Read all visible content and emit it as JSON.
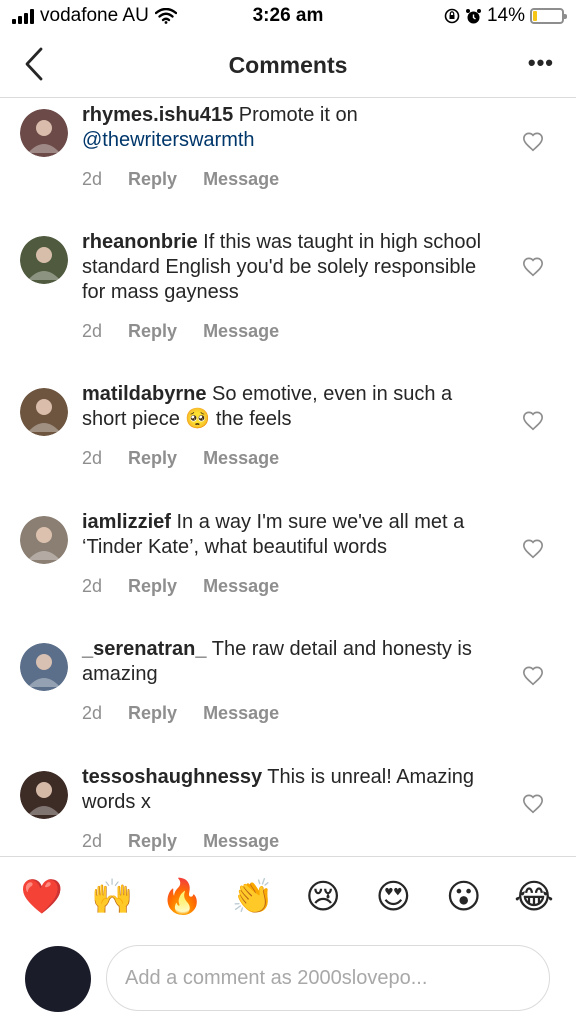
{
  "status_bar": {
    "carrier": "vodafone AU",
    "time": "3:26 am",
    "battery": "14%",
    "battery_level": 0.14
  },
  "header": {
    "title": "Comments",
    "back_icon": "chevron-left-icon",
    "more_label": "•••"
  },
  "comments": [
    {
      "user": "rhymes.ishu415",
      "text": " Promote it on ",
      "mention": "@thewriterswarmth",
      "age": "2d",
      "reply": "Reply",
      "message": "Message",
      "avatar_color": "#6b4a48"
    },
    {
      "user": "rheanonbrie",
      "text": " If this was taught in high school standard English you'd be solely responsible for mass gayness",
      "mention": "",
      "age": "2d",
      "reply": "Reply",
      "message": "Message",
      "avatar_color": "#4f5a3e"
    },
    {
      "user": "matildabyrne",
      "text": " So emotive, even in such a short piece 🥺  the feels",
      "mention": "",
      "age": "2d",
      "reply": "Reply",
      "message": "Message",
      "avatar_color": "#6e5540"
    },
    {
      "user": "iamlizzief",
      "text": " In a way I'm sure we've all met a ‘Tinder Kate’, what beautiful words",
      "mention": "",
      "age": "2d",
      "reply": "Reply",
      "message": "Message",
      "avatar_color": "#8a7f72"
    },
    {
      "user": "_serenatran_",
      "text": " The raw detail and honesty is amazing",
      "mention": "",
      "age": "2d",
      "reply": "Reply",
      "message": "Message",
      "avatar_color": "#5b6f8a"
    },
    {
      "user": "tessoshaughnessy",
      "text": " This is unreal! Amazing words x",
      "mention": "",
      "age": "2d",
      "reply": "Reply",
      "message": "Message",
      "avatar_color": "#3d2b26"
    }
  ],
  "reactions": [
    "❤️",
    "🙌",
    "🔥",
    "👏",
    "😢",
    "😍",
    "😮",
    "😂"
  ],
  "composer": {
    "placeholder": "Add a comment as 2000slovepo..."
  },
  "colors": {
    "text": "#262626",
    "muted": "#8e8e8e",
    "mention": "#00376b",
    "divider": "#dbdbdb",
    "battery": "#f5c518"
  }
}
